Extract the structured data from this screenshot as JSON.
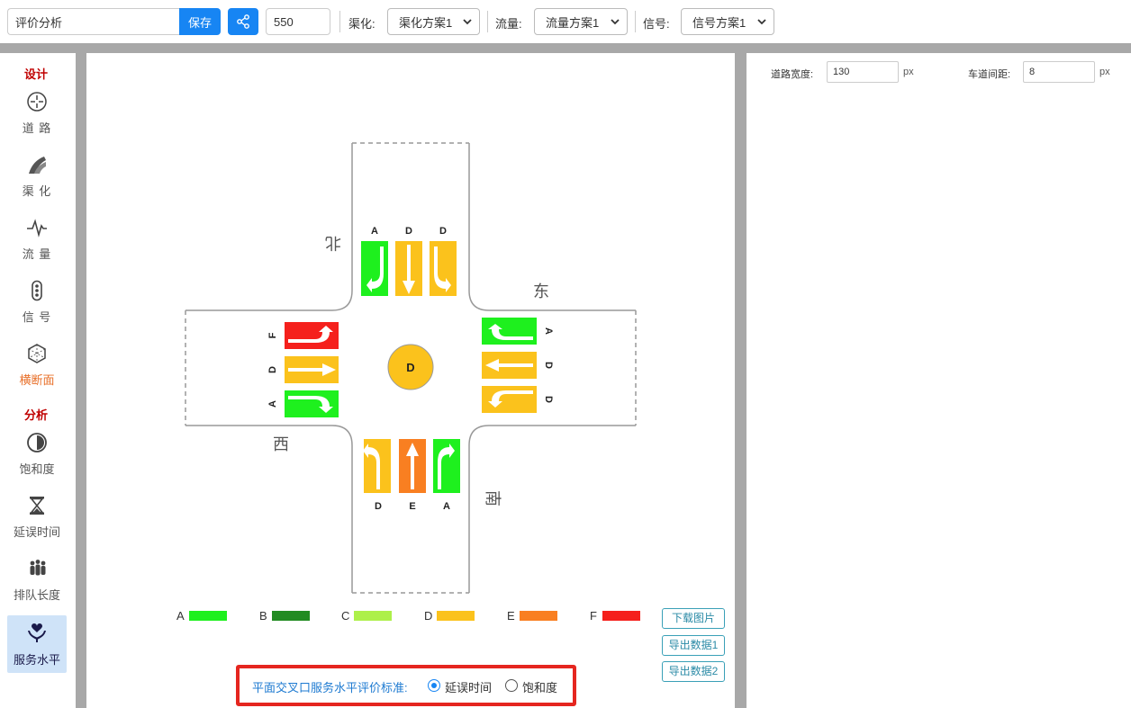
{
  "toolbar": {
    "title_value": "评价分析",
    "save_label": "保存",
    "size_value": "550",
    "channel_label": "渠化:",
    "channel_value": "渠化方案1",
    "flow_label": "流量:",
    "flow_value": "流量方案1",
    "signal_label": "信号:",
    "signal_value": "信号方案1"
  },
  "sidebar": {
    "design_section": "设计",
    "analysis_section": "分析",
    "items": [
      {
        "label": "道 路",
        "icon": "crosshair-icon"
      },
      {
        "label": "渠 化",
        "icon": "road-curve-icon"
      },
      {
        "label": "流 量",
        "icon": "pulse-icon"
      },
      {
        "label": "信 号",
        "icon": "traffic-light-icon"
      },
      {
        "label": "横断面",
        "icon": "hexagon-icon"
      },
      {
        "label": "饱和度",
        "icon": "half-circle-icon"
      },
      {
        "label": "延误时间",
        "icon": "hourglass-icon"
      },
      {
        "label": "排队长度",
        "icon": "people-queue-icon"
      },
      {
        "label": "服务水平",
        "icon": "hand-heart-icon"
      }
    ]
  },
  "intersection": {
    "center_grade": "D",
    "directions": {
      "north": "北",
      "east": "东",
      "south": "南",
      "west": "西"
    },
    "north_lanes": [
      "A",
      "D",
      "D"
    ],
    "east_lanes": [
      "A",
      "D",
      "D"
    ],
    "south_lanes": [
      "D",
      "E",
      "A"
    ],
    "west_lanes": [
      "F",
      "D",
      "A"
    ]
  },
  "legend": [
    {
      "grade": "A",
      "color": "#1ef01e"
    },
    {
      "grade": "B",
      "color": "#228b22"
    },
    {
      "grade": "C",
      "color": "#adf04a"
    },
    {
      "grade": "D",
      "color": "#fbc21c"
    },
    {
      "grade": "E",
      "color": "#f97f21"
    },
    {
      "grade": "F",
      "color": "#f5201c"
    }
  ],
  "buttons": {
    "download_image": "下载图片",
    "export_data1": "导出数据1",
    "export_data2": "导出数据2"
  },
  "criteria": {
    "label": "平面交叉口服务水平评价标准:",
    "option_delay": "延误时间",
    "option_saturation": "饱和度",
    "selected": "延误时间"
  },
  "settings": {
    "road_width_label": "道路宽度:",
    "road_width_value": "130",
    "road_width_unit": "px",
    "lane_gap_label": "车道间距:",
    "lane_gap_value": "8",
    "lane_gap_unit": "px"
  },
  "colors": {
    "accent": "#1785f3",
    "divider": "#a8a8a8",
    "highlight_border": "#e5261f",
    "section_red": "#c00000",
    "grade_A": "#1ef01e",
    "grade_D": "#fbc21c",
    "grade_E": "#f97f21",
    "grade_F": "#f5201c"
  }
}
